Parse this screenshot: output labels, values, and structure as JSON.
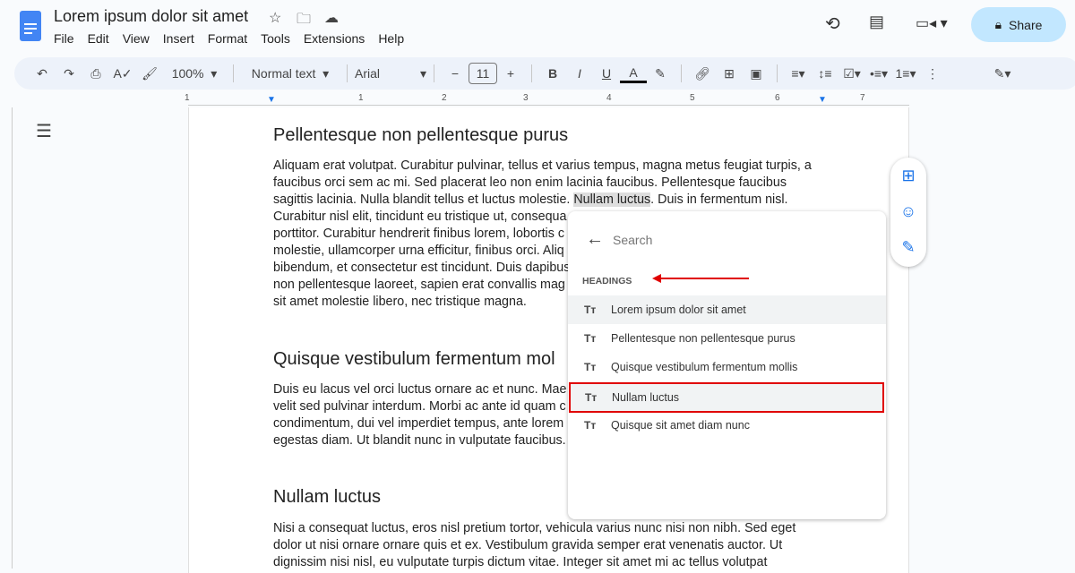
{
  "app": {
    "title": "Lorem ipsum dolor sit amet",
    "menu": [
      "File",
      "Edit",
      "View",
      "Insert",
      "Format",
      "Tools",
      "Extensions",
      "Help"
    ],
    "share_label": "Share",
    "accent": "#1a73e8"
  },
  "toolbar": {
    "zoom": "100%",
    "style": "Normal text",
    "font": "Arial",
    "font_size": "11"
  },
  "ruler": [
    "1",
    "1",
    "2",
    "3",
    "4",
    "5",
    "6",
    "7"
  ],
  "doc": {
    "h1": "Pellentesque non pellentesque purus",
    "p1": [
      "Aliquam erat volutpat. Curabitur pulvinar, tellus et varius tempus, magna metus feugiat turpis, a",
      "faucibus orci sem ac mi. Sed placerat leo non enim lacinia faucibus. Pellentesque faucibus",
      "sagittis lacinia. Nulla blandit tellus et luctus molestie.",
      "Nullam luctus",
      ". Duis in fermentum nisl.",
      "Curabitur nisl elit, tincidunt eu tristique ut, consequa",
      "porttitor. Curabitur hendrerit finibus lorem, lobortis c",
      "molestie, ullamcorper urna efficitur, finibus orci. Aliq",
      "bibendum, et consectetur est tincidunt. Duis dapibus",
      "non pellentesque laoreet, sapien erat convallis mag",
      "sit amet molestie libero, nec tristique magna."
    ],
    "h2": "Quisque vestibulum fermentum mol",
    "p2": [
      "Duis eu lacus vel orci luctus ornare ac et nunc. Mae",
      "velit sed pulvinar interdum. Morbi ac ante id quam c",
      "condimentum, dui vel imperdiet tempus, ante lorem",
      "egestas diam. Ut blandit nunc in vulputate faucibus."
    ],
    "h3": "Nullam luctus",
    "p3": [
      "Nisi a consequat luctus, eros nisl pretium tortor, vehicula varius nunc nisi non nibh. Sed eget",
      "dolor ut nisi ornare ornare quis et ex. Vestibulum gravida semper erat venenatis auctor. Ut",
      "dignissim nisi nisl, eu vulputate turpis dictum vitae. Integer sit amet mi ac tellus volutpat"
    ]
  },
  "popup": {
    "search_placeholder": "Search",
    "section": "HEADINGS",
    "heading_icon": "Tт",
    "headings": [
      "Lorem ipsum dolor sit amet",
      "Pellentesque non pellentesque purus",
      "Quisque vestibulum fermentum mollis",
      "Nullam luctus",
      "Quisque sit amet diam nunc"
    ],
    "selected": "Nullam luctus",
    "highlight_color": "#e00000"
  }
}
